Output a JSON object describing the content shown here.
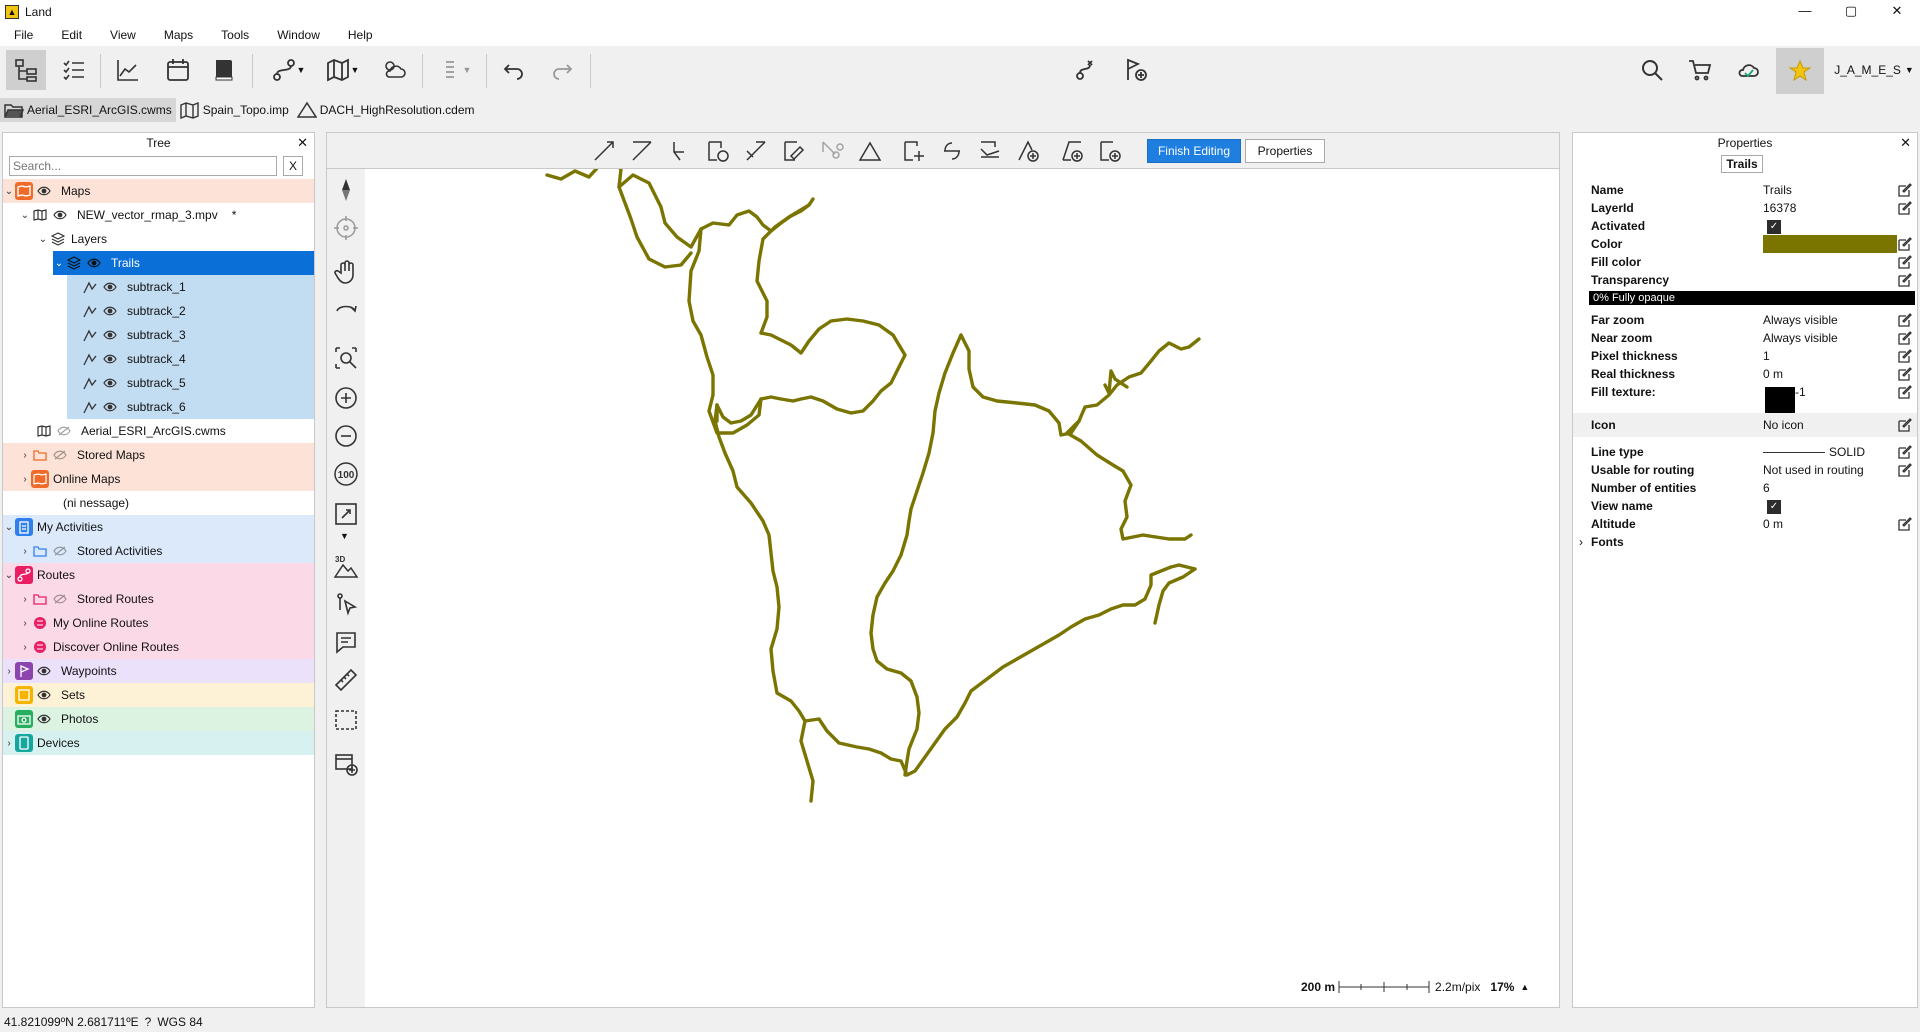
{
  "window": {
    "title": "Land",
    "minimize": "—",
    "maximize": "▢",
    "close": "✕"
  },
  "menu": [
    "File",
    "Edit",
    "View",
    "Maps",
    "Tools",
    "Window",
    "Help"
  ],
  "user": {
    "name": "J_A_M_E_S"
  },
  "file_tabs": [
    {
      "label": "Aerial_ESRI_ArcGIS.cwms",
      "icon": "folder-open-icon"
    },
    {
      "label": "Spain_Topo.imp",
      "icon": "map-icon"
    },
    {
      "label": "DACH_HighResolution.cdem",
      "icon": "terrain-icon"
    }
  ],
  "tree": {
    "title": "Tree",
    "close": "✕",
    "search_placeholder": "Search...",
    "clear": "X",
    "items": [
      {
        "label": "Maps",
        "bg": "#fde3d7"
      },
      {
        "label": "NEW_vector_rmap_3.mpv",
        "suffix": "*"
      },
      {
        "label": "Layers"
      },
      {
        "label": "Trails"
      },
      {
        "label": "subtrack_1"
      },
      {
        "label": "subtrack_2"
      },
      {
        "label": "subtrack_3"
      },
      {
        "label": "subtrack_4"
      },
      {
        "label": "subtrack_5"
      },
      {
        "label": "subtrack_6"
      },
      {
        "label": "Aerial_ESRI_ArcGIS.cwms"
      },
      {
        "label": "Stored Maps"
      },
      {
        "label": "Online Maps"
      },
      {
        "label": "(ni nessage)"
      },
      {
        "label": "My Activities"
      },
      {
        "label": "Stored Activities"
      },
      {
        "label": "Routes"
      },
      {
        "label": "Stored Routes"
      },
      {
        "label": "My Online Routes"
      },
      {
        "label": "Discover Online Routes"
      },
      {
        "label": "Waypoints"
      },
      {
        "label": "Sets"
      },
      {
        "label": "Photos"
      },
      {
        "label": "Devices"
      }
    ]
  },
  "edit_toolbar": {
    "finish_label": "Finish Editing",
    "properties_label": "Properties"
  },
  "map": {
    "track_color": "#7a7400",
    "scale": {
      "distance": "200 m",
      "resolution": "2.2m/pix",
      "zoom": "17%"
    }
  },
  "properties": {
    "title": "Properties",
    "close": "✕",
    "tab": "Trails",
    "rows": {
      "name": {
        "key": "Name",
        "value": "Trails"
      },
      "layerid": {
        "key": "LayerId",
        "value": "16378"
      },
      "activated": {
        "key": "Activated",
        "value": "✓"
      },
      "color": {
        "key": "Color",
        "value": "#7a7400"
      },
      "fillcolor": {
        "key": "Fill color"
      },
      "transparency": {
        "key": "Transparency",
        "value": "0% Fully opaque"
      },
      "farzoom": {
        "key": "Far zoom",
        "value": "Always visible"
      },
      "nearzoom": {
        "key": "Near zoom",
        "value": "Always visible"
      },
      "pixelthickness": {
        "key": "Pixel thickness",
        "value": "1"
      },
      "realthickness": {
        "key": "Real thickness",
        "value": "0 m"
      },
      "filltexture": {
        "key": "Fill texture:",
        "value": "-1"
      },
      "icon": {
        "key": "Icon",
        "value": "No icon"
      },
      "linetype": {
        "key": "Line type",
        "value": "SOLID"
      },
      "routing": {
        "key": "Usable for routing",
        "value": "Not used in routing"
      },
      "entities": {
        "key": "Number of entities",
        "value": "6"
      },
      "viewname": {
        "key": "View name",
        "value": "✓"
      },
      "altitude": {
        "key": "Altitude",
        "value": "0 m"
      },
      "fonts": {
        "key": "Fonts"
      }
    }
  },
  "status": {
    "coords": "41.821099ºN 2.681711ºE",
    "q": "?",
    "datum": "WGS 84"
  }
}
